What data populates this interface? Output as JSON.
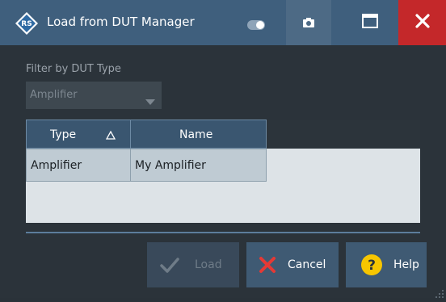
{
  "window": {
    "title": "Load from DUT Manager",
    "app_logo_icon": "rohde-schwarz-logo-icon",
    "title_buttons": {
      "toggle_icon": "toggle-icon",
      "screenshot_icon": "camera-icon",
      "maximize_icon": "maximize-icon",
      "close_icon": "close-icon"
    }
  },
  "filter": {
    "label": "Filter by DUT Type",
    "selected_value": "Amplifier",
    "dropdown_icon": "chevron-down-icon"
  },
  "table": {
    "columns": [
      "Type",
      "Name"
    ],
    "sort_column": "Type",
    "sort_icon": "sort-ascending-icon",
    "rows": [
      {
        "type": "Amplifier",
        "name": "My Amplifier"
      }
    ]
  },
  "buttons": {
    "load": {
      "label": "Load",
      "icon": "checkmark-icon",
      "enabled": false
    },
    "cancel": {
      "label": "Cancel",
      "icon": "close-x-icon"
    },
    "help": {
      "label": "Help",
      "icon": "question-icon"
    }
  },
  "colors": {
    "title_bar": "#3f5f7d",
    "close_button": "#c4282a",
    "body": "#2b333a",
    "button": "#3f5a73",
    "help_icon": "#f7c600",
    "cancel_icon": "#e53935"
  }
}
